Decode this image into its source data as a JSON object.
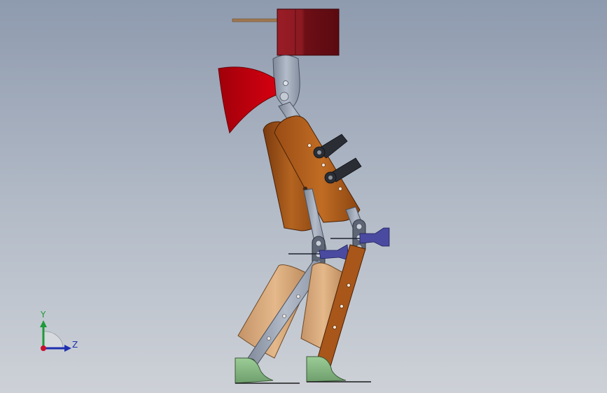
{
  "triad": {
    "y_label": "Y",
    "z_label": "Z",
    "colors": {
      "y_axis": "#1e9a3a",
      "z_axis": "#1f2fb0",
      "origin": "#c8102e"
    }
  },
  "colors": {
    "background_top": "#8e9aae",
    "background_bottom": "#cdd1d7",
    "motor_red": "#8a1a24",
    "foot_green": "#8fbf8a",
    "link_gray": "#9aa4b4",
    "torso_brown": "#a8561a",
    "shin_wood": "#d8a878",
    "bracket_blue": "#4a4aa0"
  }
}
